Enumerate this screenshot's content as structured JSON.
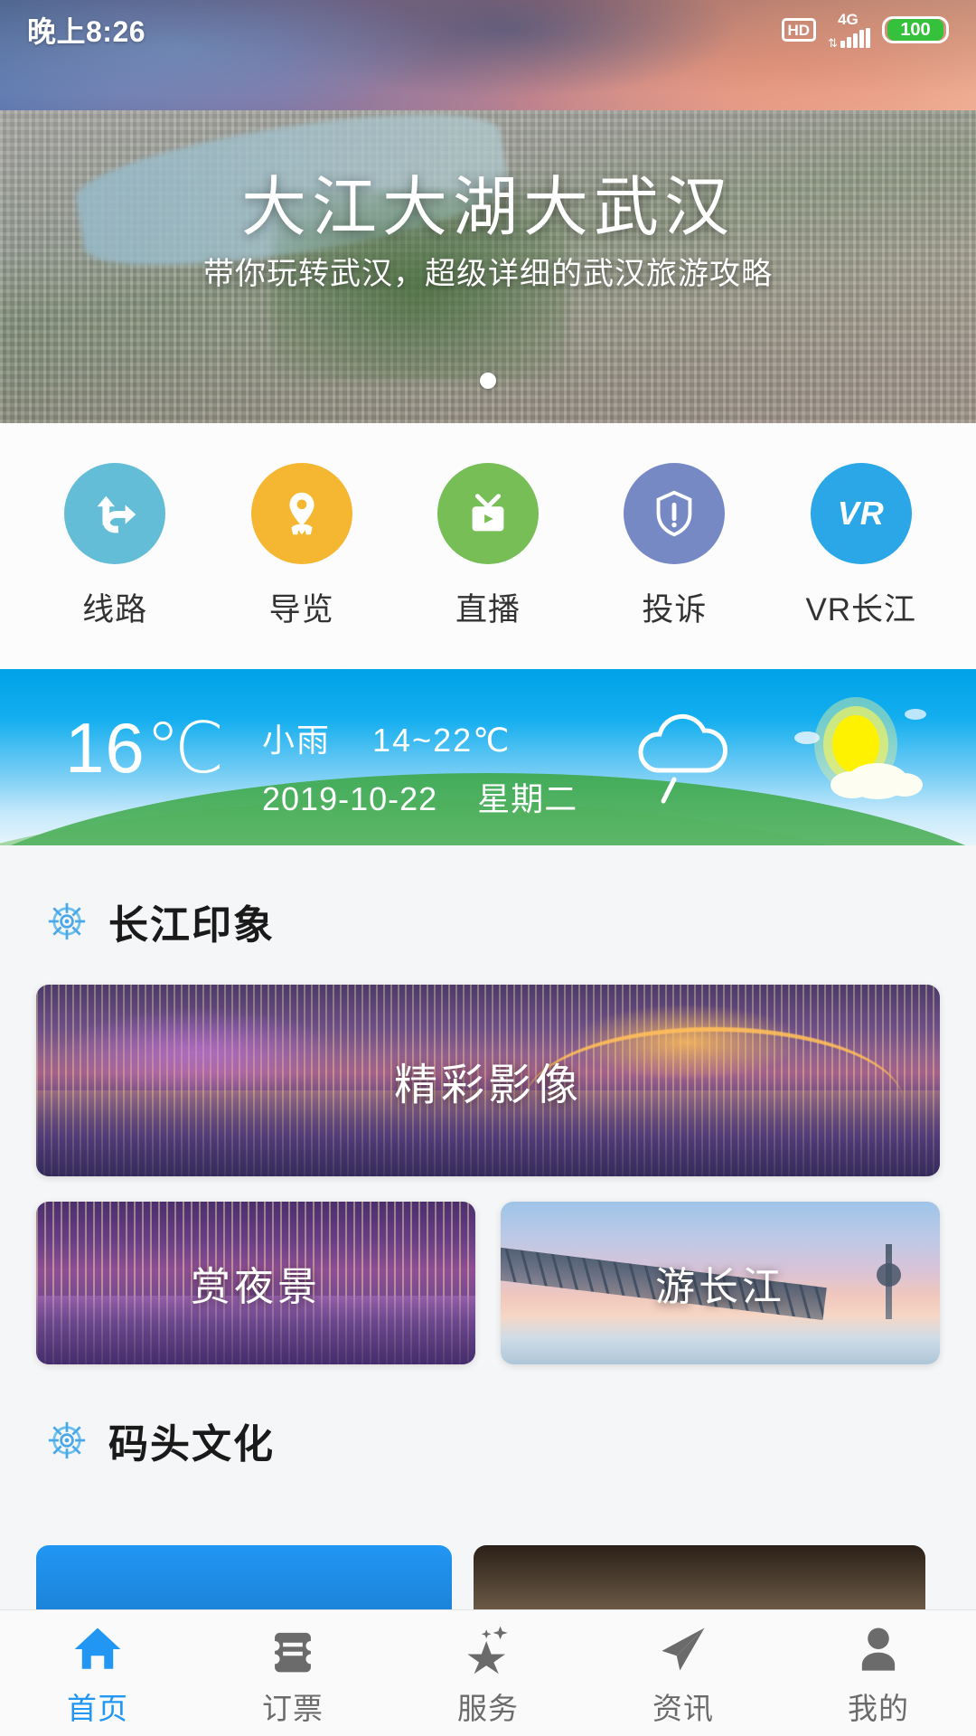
{
  "status_bar": {
    "time": "晚上8:26",
    "hd_label": "HD",
    "network": "4G",
    "battery": "100"
  },
  "hero": {
    "title": "大江大湖大武汉",
    "subtitle": "带你玩转武汉，超级详细的武汉旅游攻略",
    "dot_count": 1,
    "icon": "carousel-dot"
  },
  "quick_nav": {
    "items": [
      {
        "label": "线路",
        "icon": "route-arrow-icon",
        "color": "#63bdd6"
      },
      {
        "label": "导览",
        "icon": "map-pin-guide-icon",
        "color": "#f5b731"
      },
      {
        "label": "直播",
        "icon": "tv-live-icon",
        "color": "#76be55"
      },
      {
        "label": "投诉",
        "icon": "shield-alert-icon",
        "color": "#7689c4"
      },
      {
        "label": "VR长江",
        "icon": "vr-text-icon",
        "color": "#2ba7e8",
        "text": "VR"
      }
    ]
  },
  "weather": {
    "temperature": "16℃",
    "condition": "小雨",
    "range": "14~22℃",
    "date": "2019-10-22",
    "weekday": "星期二",
    "rain_icon": "rain-cloud-icon",
    "sun_icon": "sun-cloud-icon",
    "accent": "#00a2e8"
  },
  "sections": [
    {
      "title": "长江印象",
      "icon": "ship-helm-icon",
      "feature_card": {
        "label": "精彩影像",
        "image": "wuhan-night-panorama"
      },
      "cards": [
        {
          "label": "赏夜景",
          "image": "purple-night-skyline"
        },
        {
          "label": "游长江",
          "image": "yangtze-bridge-sunset"
        }
      ]
    },
    {
      "title": "码头文化",
      "icon": "ship-helm-icon",
      "partial_cards": [
        {
          "image": "blue-card"
        },
        {
          "image": "dark-dock-card"
        },
        {
          "image": "edge-card"
        }
      ]
    }
  ],
  "bottom_nav": {
    "items": [
      {
        "label": "首页",
        "icon": "home-icon",
        "active": true
      },
      {
        "label": "订票",
        "icon": "ticket-icon",
        "active": false
      },
      {
        "label": "服务",
        "icon": "star-icon",
        "active": false
      },
      {
        "label": "资讯",
        "icon": "paper-plane-icon",
        "active": false
      },
      {
        "label": "我的",
        "icon": "person-icon",
        "active": false
      }
    ],
    "active_color": "#2196f3",
    "inactive_color": "#6b6b6b"
  }
}
